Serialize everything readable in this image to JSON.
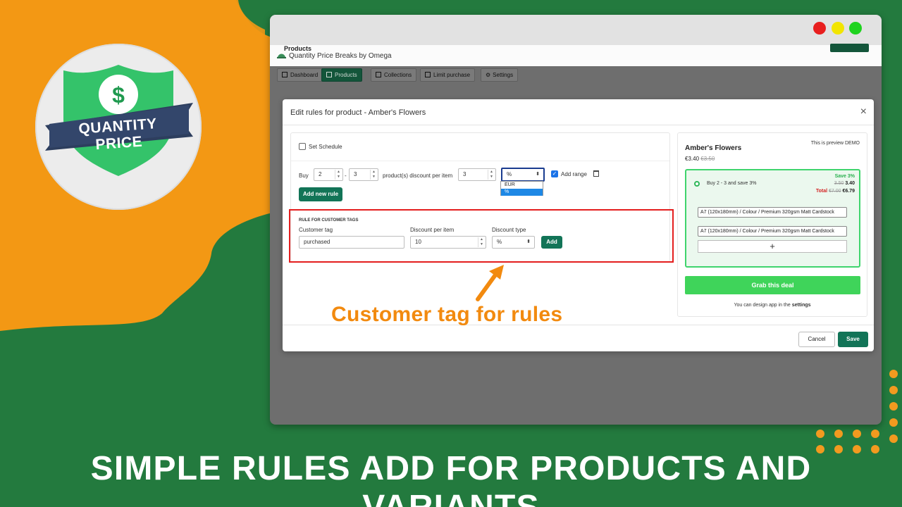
{
  "background": {
    "green": "#237a3e",
    "orange": "#f39814"
  },
  "logo": {
    "text": "QUANTITY PRICE",
    "symbol": "$",
    "icon": "shield-dollar-icon"
  },
  "window": {
    "app_title": "Quantity Price Breaks by Omega",
    "nav": [
      {
        "label": "Dashboard"
      },
      {
        "label": "Products"
      },
      {
        "label": "Collections"
      },
      {
        "label": "Limit purchase"
      },
      {
        "label": "Settings"
      }
    ],
    "bg_heading": "Products"
  },
  "modal": {
    "title": "Edit rules for product - Amber's Flowers",
    "close": "×",
    "schedule_label": "Set Schedule",
    "rule": {
      "buy_label": "Buy",
      "from": "2",
      "dash": "-",
      "to": "3",
      "discount_label": "product(s) discount per item",
      "discount_value": "3",
      "type_value": "%",
      "type_options": [
        "EUR",
        "%"
      ],
      "add_range_label": "Add range"
    },
    "add_new_rule": "Add new rule",
    "customer_tags": {
      "section_title": "RULE FOR CUSTOMER TAGS",
      "tag_label": "Customer tag",
      "tag_value": "purchased",
      "discount_label": "Discount per item",
      "discount_value": "10",
      "type_label": "Discount type",
      "type_value": "%",
      "add_button": "Add"
    },
    "preview": {
      "product_name": "Amber's Flowers",
      "price": "€3.40",
      "old_price": "€3.50",
      "demo_note": "This is preview DEMO",
      "offer_text": "Buy 2 - 3 and save 3%",
      "save_text": "Save 3%",
      "old_unit": "3.50",
      "new_unit": "3.40",
      "total_label": "Total",
      "total_old": "€7.00",
      "total_new": "€6.79",
      "variant_1": "A7 (120x180mm) / Colour / Premium 320gsm Matt Cardstock",
      "variant_2": "A7 (120x180mm) / Colour / Premium 320gsm Matt Cardstock",
      "plus": "+",
      "grab_button": "Grab this deal",
      "design_note_prefix": "You can design app in the",
      "design_note_link": "settings"
    },
    "cancel": "Cancel",
    "save": "Save"
  },
  "annotation": "Customer tag for rules",
  "banner": "SIMPLE RULES ADD FOR PRODUCTS AND VARIANTS"
}
